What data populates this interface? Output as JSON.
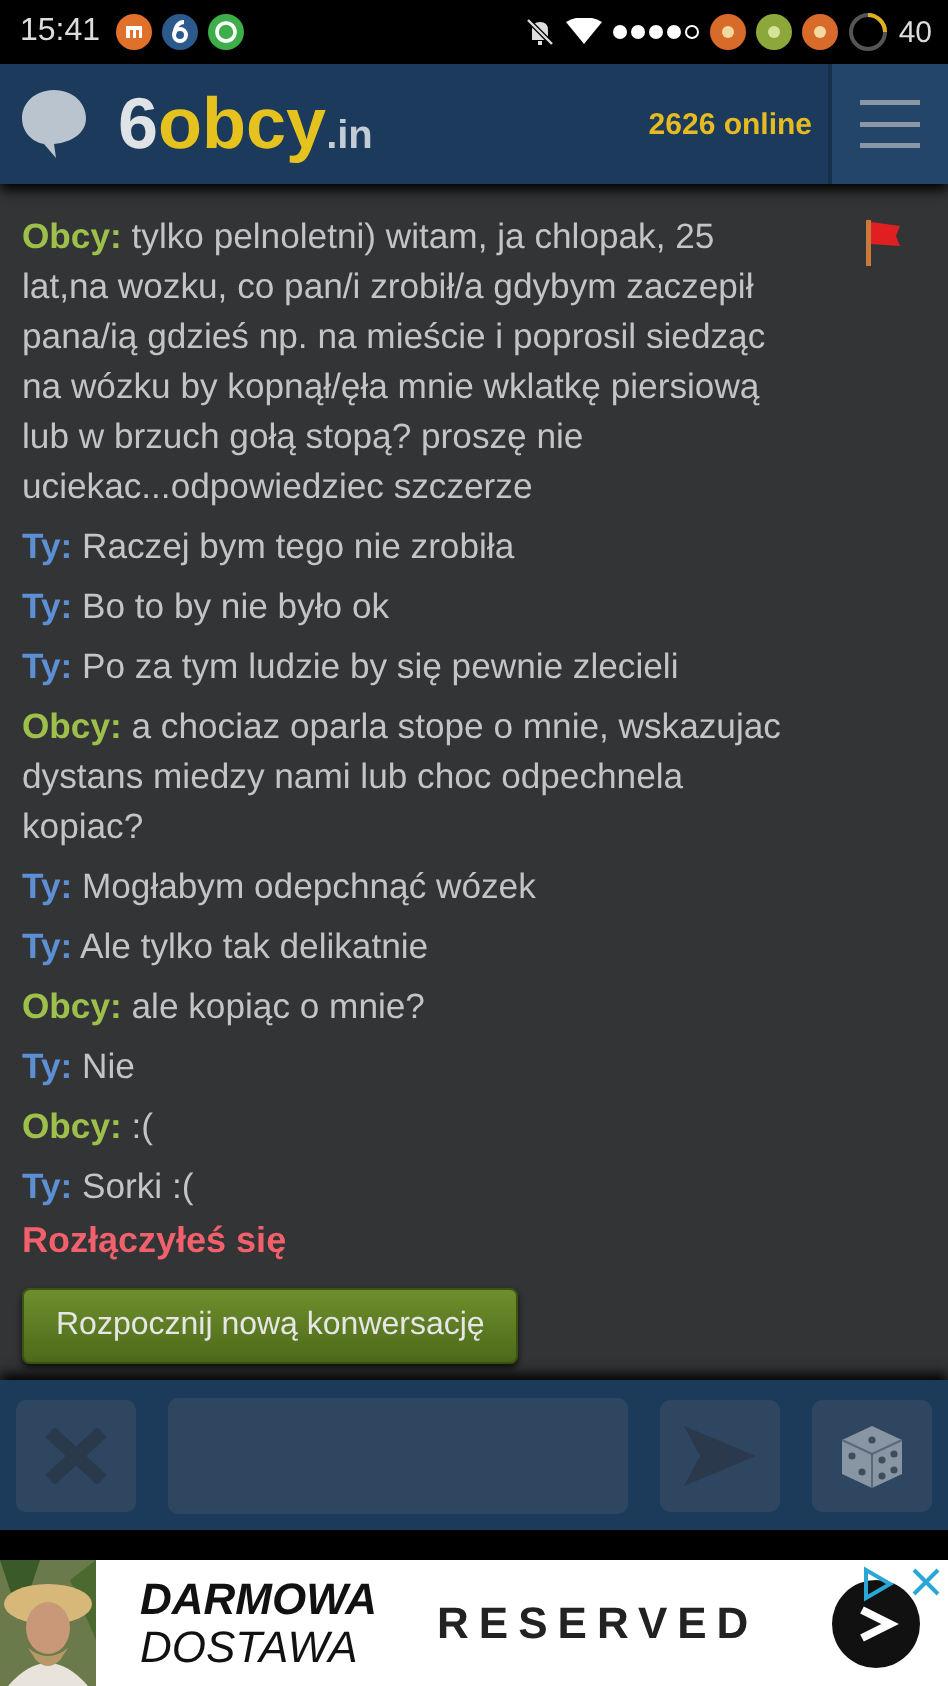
{
  "status_bar": {
    "time": "15:41",
    "battery": "40"
  },
  "header": {
    "logo": [
      {
        "text": "6",
        "kind": "digit"
      },
      {
        "text": "obcy",
        "kind": "name"
      },
      {
        "text": ".in",
        "kind": "domain"
      }
    ],
    "online": "2626 online"
  },
  "messages": [
    {
      "sender": "Obcy:",
      "kind": "stranger",
      "text": "tylko pelnoletni) witam, ja chlopak, 25 lat,na wozku, co pan/i zrobił/a gdybym zaczepił pana/ią gdzieś np. na mieście i poprosil siedząc na wózku by kopnął/ęła mnie wklatkę piersiową lub w brzuch gołą stopą? proszę nie uciekac...odpowiedziec szczerze",
      "flag": true
    },
    {
      "sender": "Ty:",
      "kind": "me",
      "text": "Raczej bym tego nie zrobiła",
      "flag": false
    },
    {
      "sender": "Ty:",
      "kind": "me",
      "text": "Bo to by nie było ok",
      "flag": false
    },
    {
      "sender": "Ty:",
      "kind": "me",
      "text": "Po za tym ludzie by się pewnie zlecieli",
      "flag": false
    },
    {
      "sender": "Obcy:",
      "kind": "stranger",
      "text": "a chociaz oparla stope o mnie, wskazujac dystans miedzy nami lub choc odpechnela kopiac?",
      "flag": false
    },
    {
      "sender": "Ty:",
      "kind": "me",
      "text": "Mogłabym odepchnąć wózek",
      "flag": false
    },
    {
      "sender": "Ty:",
      "kind": "me",
      "text": "Ale tylko tak delikatnie",
      "flag": false
    },
    {
      "sender": "Obcy:",
      "kind": "stranger",
      "text": "ale kopiąc o mnie?",
      "flag": false
    },
    {
      "sender": "Ty:",
      "kind": "me",
      "text": "Nie",
      "flag": false
    },
    {
      "sender": "Obcy:",
      "kind": "stranger",
      "text": ":(",
      "flag": false
    },
    {
      "sender": "Ty:",
      "kind": "me",
      "text": "Sorki :(",
      "flag": false
    }
  ],
  "disconnected": "Rozłączyłeś się",
  "new_chat_button": "Rozpocznij nową konwersację",
  "ad": {
    "kind": "picture",
    "line_1": "DARMOWA",
    "line_2": "DOSTAWA",
    "brand": "RESERVED"
  }
}
